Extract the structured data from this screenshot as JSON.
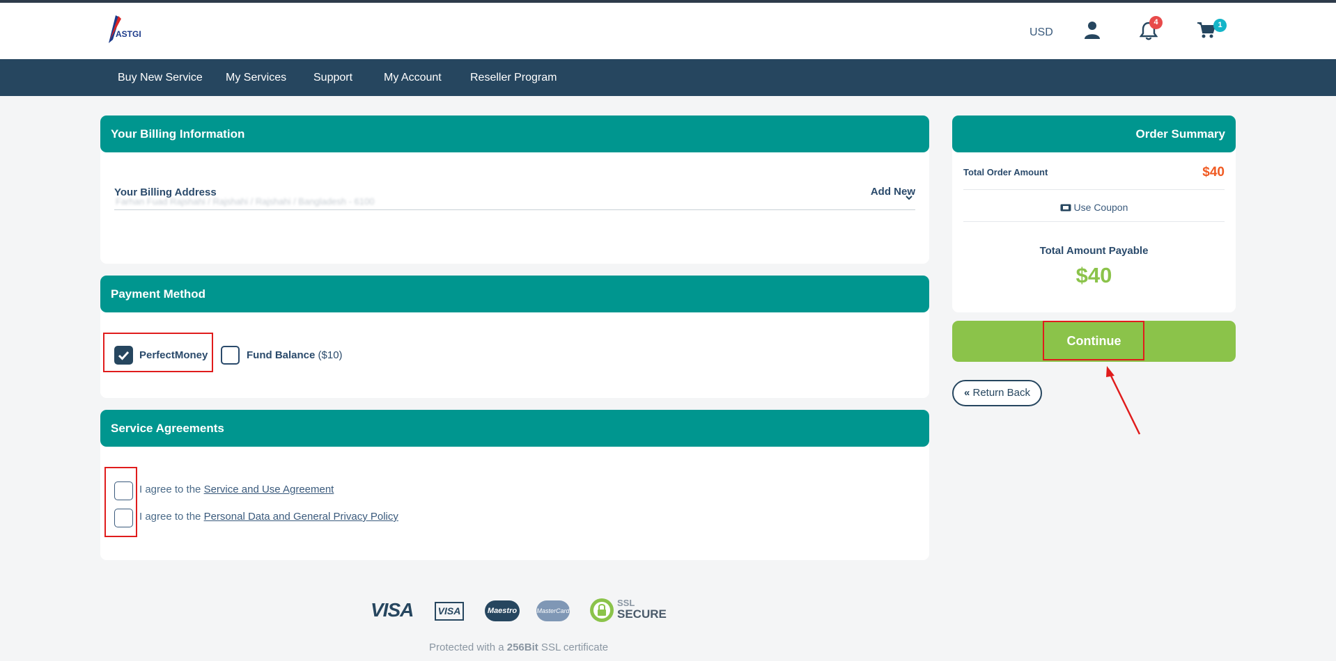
{
  "header": {
    "logo_text": "ASTGD",
    "currency": "USD",
    "notifications_count": "4",
    "cart_count": "1"
  },
  "nav": {
    "items": [
      {
        "label": "Buy New Service"
      },
      {
        "label": "My Services"
      },
      {
        "label": "Support"
      },
      {
        "label": "My Account"
      },
      {
        "label": "Reseller Program"
      }
    ]
  },
  "billing": {
    "title": "Your Billing Information",
    "address_label": "Your Billing Address",
    "add_new": "Add New",
    "address_value": "Farhan Fuad Rajshahi / Rajshahi / Rajshahi / Bangladesh - 6100"
  },
  "payment": {
    "title": "Payment Method",
    "options": [
      {
        "label": "PerfectMoney",
        "extra": "",
        "checked": true
      },
      {
        "label": "Fund Balance",
        "extra": "($10)",
        "checked": false
      }
    ]
  },
  "agreements": {
    "title": "Service Agreements",
    "items": [
      {
        "prefix": "I agree to the ",
        "link": "Service and Use Agreement"
      },
      {
        "prefix": "I agree to the ",
        "link": "Personal Data and General Privacy Policy"
      }
    ]
  },
  "summary": {
    "title": "Order Summary",
    "total_order_label": "Total Order Amount",
    "total_order_value": "$40",
    "coupon_label": "Use Coupon",
    "payable_label": "Total Amount Payable",
    "payable_value": "$40"
  },
  "actions": {
    "continue_label": "Continue",
    "return_label": "Return Back"
  },
  "footer": {
    "logos": [
      "VISA",
      "VISA",
      "Maestro",
      "MasterCard",
      "SSL",
      "SECURE"
    ],
    "ssl_prefix": "Protected with a ",
    "ssl_bold": "256Bit",
    "ssl_suffix": " SSL certificate"
  },
  "colors": {
    "teal": "#00968f",
    "navy": "#26465f",
    "green": "#8bc34a",
    "orange": "#f05a22",
    "annotation_red": "#e01c1c"
  }
}
